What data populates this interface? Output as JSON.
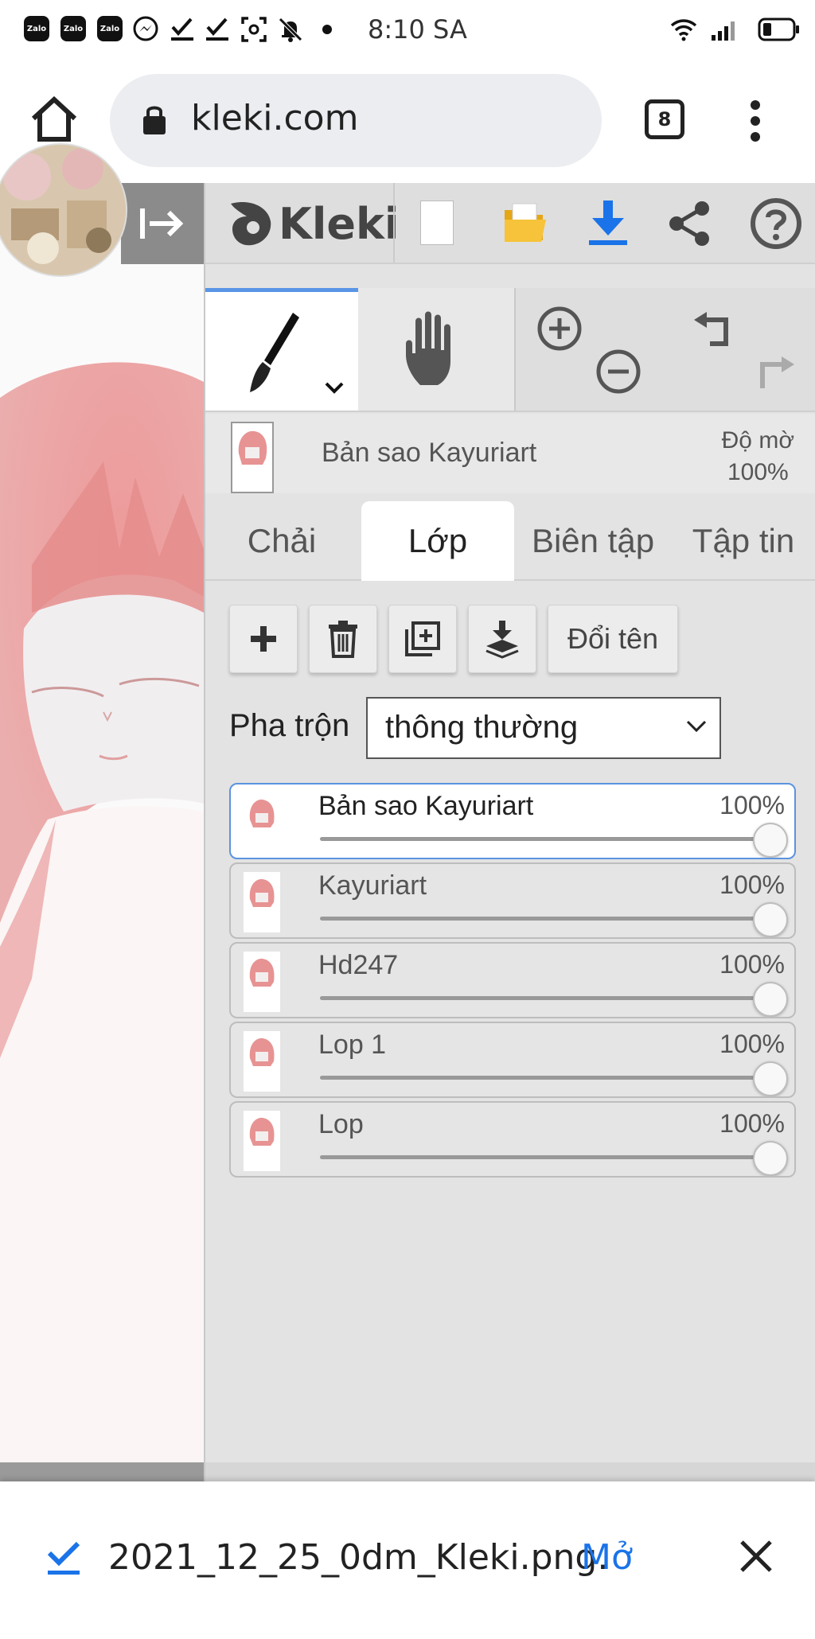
{
  "status_bar": {
    "time": "8:10 SA",
    "zalo_label": "Zalo"
  },
  "browser": {
    "url": "kleki.com",
    "tab_count": "8"
  },
  "app": {
    "logo_text": "Kleki",
    "accent_color": "#1a73e8",
    "active_tool_indicator": "#5a95e6"
  },
  "layer_info": {
    "name": "Bản sao Kayuriart",
    "opacity_label": "Độ mờ",
    "opacity_value": "100%"
  },
  "tabs": [
    {
      "label": "Chải"
    },
    {
      "label": "Lớp"
    },
    {
      "label": "Biên tập"
    },
    {
      "label": "Tập tin"
    }
  ],
  "layer_actions": {
    "rename_label": "Đổi tên"
  },
  "blend": {
    "label": "Pha trộn",
    "value": "thông thường"
  },
  "layers": [
    {
      "name": "Bản sao Kayuriart",
      "opacity": "100%",
      "active": true
    },
    {
      "name": "Kayuriart",
      "opacity": "100%",
      "active": false
    },
    {
      "name": "Hd247",
      "opacity": "100%",
      "active": false
    },
    {
      "name": "Lop 1",
      "opacity": "100%",
      "active": false
    },
    {
      "name": "Lop",
      "opacity": "100%",
      "active": false
    }
  ],
  "download": {
    "filename": "2021_12_25_0dm_Kleki.png.",
    "open_label": "Mở"
  }
}
